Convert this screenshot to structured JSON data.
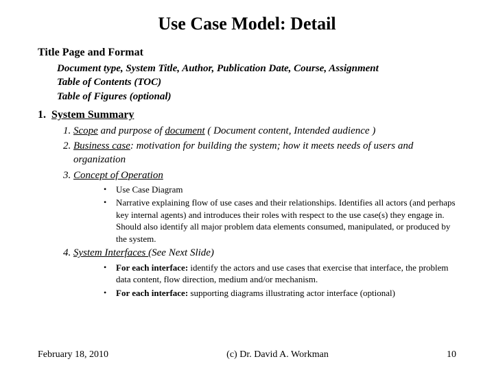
{
  "title": "Use Case Model: Detail",
  "section1": {
    "heading": "Title Page and Format",
    "lines": [
      "Document type, System Title, Author, Publication Date, Course, Assignment",
      "Table of Contents (TOC)",
      "Table of Figures (optional)"
    ]
  },
  "section2": {
    "number": "1.",
    "heading": "System Summary",
    "items": {
      "i1": {
        "u1": "Scope",
        "mid": " and purpose of ",
        "u2": "document",
        "rest": " ( Document content, Intended audience )"
      },
      "i2": {
        "u": "Business case",
        "colon": ": ",
        "rest": "motivation for building the system; how it meets needs of users and organization"
      },
      "i3": {
        "u": "Concept of Operation",
        "bullets": [
          "Use Case Diagram",
          "Narrative explaining flow of use cases and their relationships.  Identifies all actors (and perhaps key internal agents) and introduces their roles with respect to the use case(s) they engage in.  Should also identify all major problem data elements consumed, manipulated, or produced by the system."
        ]
      },
      "i4": {
        "u": "System Interfaces ",
        "paren": " (See Next Slide)",
        "bullets": {
          "b1": {
            "lead": "For each interface:",
            "rest": "  identify the actors and use cases that exercise that interface, the problem data content, flow direction, medium and/or mechanism."
          },
          "b2": {
            "lead": "For each interface:",
            "rest": " supporting diagrams illustrating actor interface (optional)"
          }
        }
      }
    }
  },
  "footer": {
    "date": "February 18, 2010",
    "copyright": "(c) Dr. David A. Workman",
    "page": "10"
  }
}
